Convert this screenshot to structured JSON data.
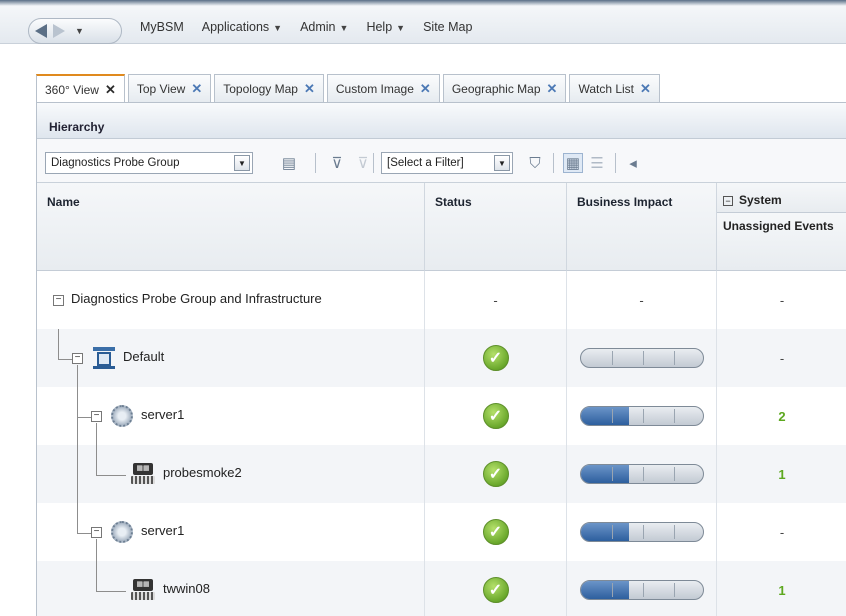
{
  "menu": {
    "items": [
      {
        "label": "MyBSM",
        "caret": false
      },
      {
        "label": "Applications",
        "caret": true
      },
      {
        "label": "Admin",
        "caret": true
      },
      {
        "label": "Help",
        "caret": true
      },
      {
        "label": "Site Map",
        "caret": false
      }
    ]
  },
  "tabs": [
    {
      "label": "360° View",
      "active": true
    },
    {
      "label": "Top View"
    },
    {
      "label": "Topology Map"
    },
    {
      "label": "Custom Image"
    },
    {
      "label": "Geographic Map"
    },
    {
      "label": "Watch List"
    }
  ],
  "panel": {
    "title": "Hierarchy",
    "view_select": "Diagnostics Probe Group",
    "filter_select": "[Select a Filter]"
  },
  "columns": {
    "name": "Name",
    "status": "Status",
    "business_impact": "Business Impact",
    "system_group": "System",
    "unassigned_events": "Unassigned Events"
  },
  "rows": [
    {
      "name": "Diagnostics Probe Group and Infrastructure",
      "status": "-",
      "impact": null,
      "events": "-"
    },
    {
      "name": "Default",
      "status": "ok",
      "impact": 0,
      "events": "-"
    },
    {
      "name": "server1",
      "status": "ok",
      "impact": 0.4,
      "events": "2"
    },
    {
      "name": "probesmoke2",
      "status": "ok",
      "impact": 0.4,
      "events": "1"
    },
    {
      "name": "server1",
      "status": "ok",
      "impact": 0.4,
      "events": "-"
    },
    {
      "name": "twwin08",
      "status": "ok",
      "impact": 0.4,
      "events": "1"
    }
  ],
  "colors": {
    "active_tab_accent": "#e08a1e",
    "status_ok": "#6aa82c",
    "impact_fill": "#2d5f9e",
    "event_count": "#5da81f"
  }
}
